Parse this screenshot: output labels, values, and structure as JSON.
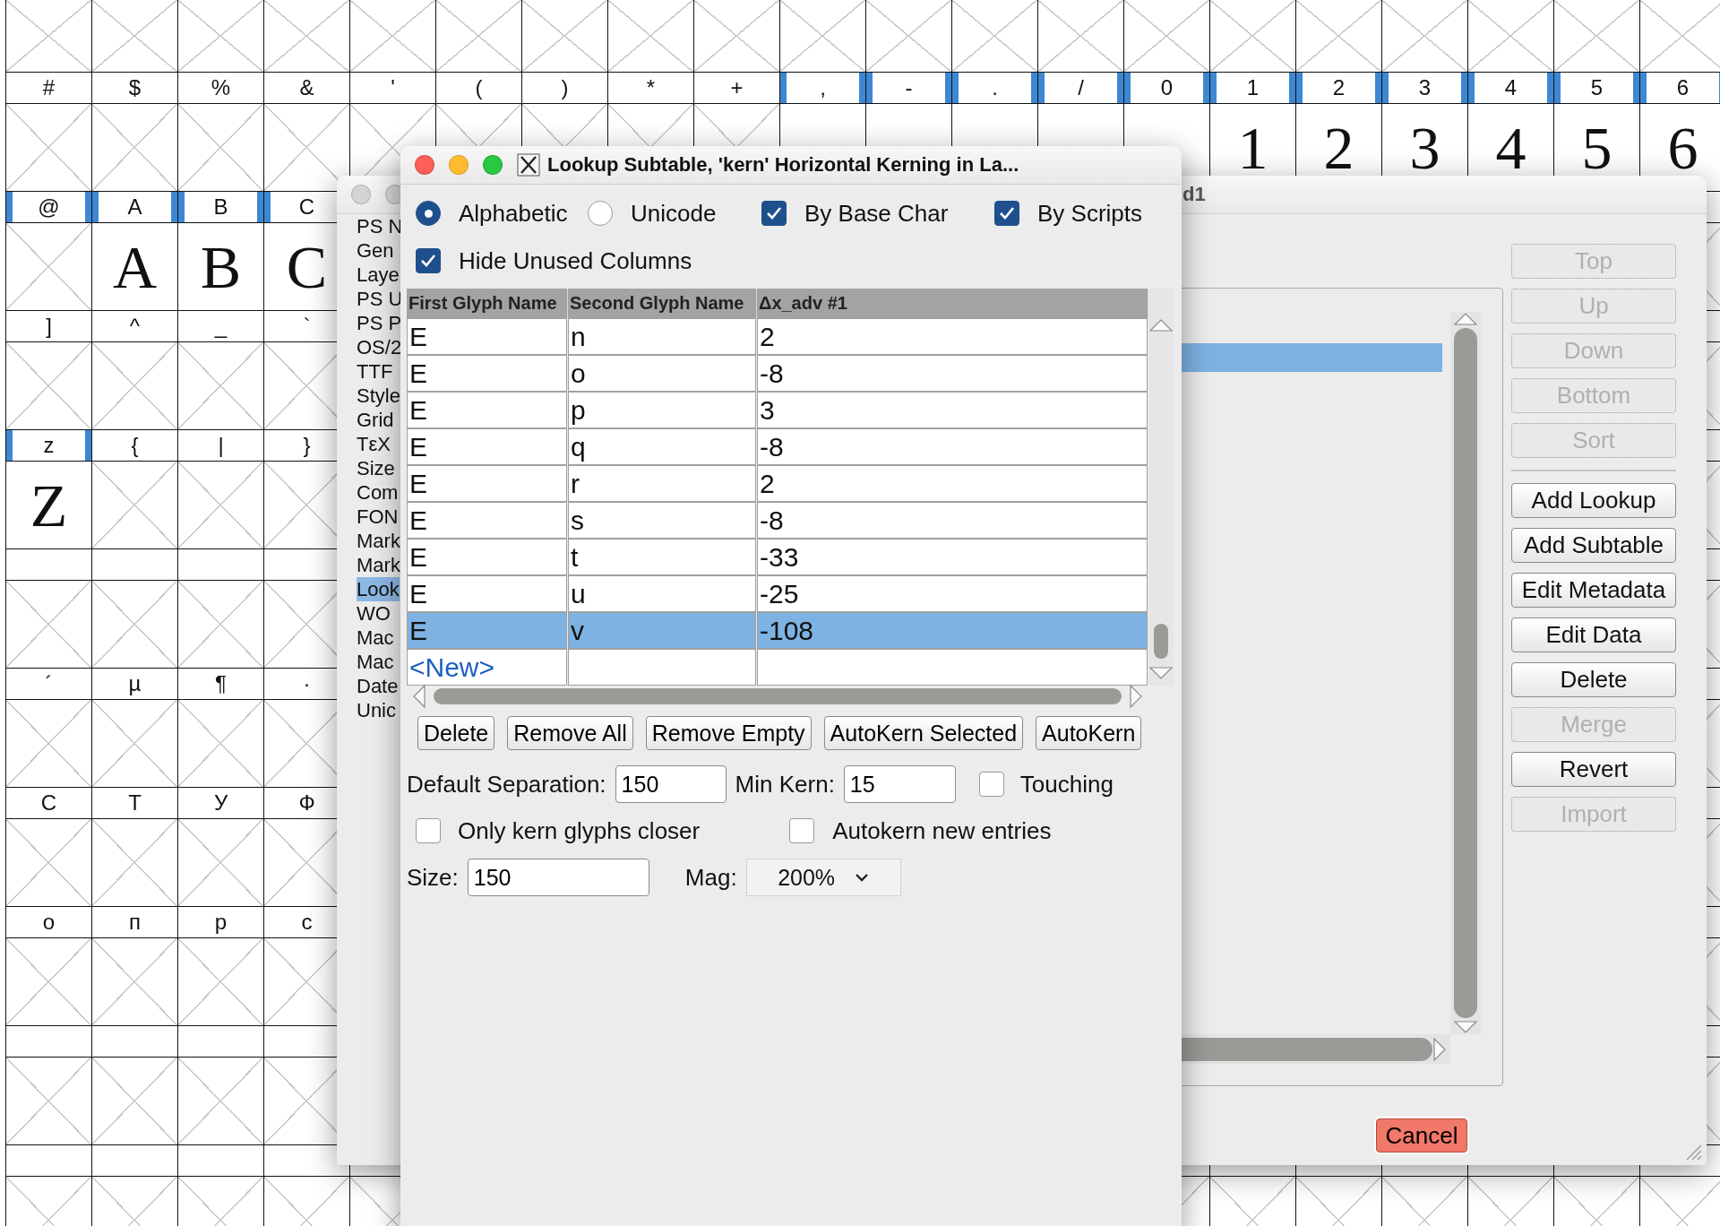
{
  "glyph_grid": {
    "rows": [
      {
        "kind": "glyphs",
        "cells": [
          {
            "label": "#",
            "marked": false,
            "kind": "empty"
          },
          {
            "label": "$",
            "marked": false,
            "kind": "empty"
          },
          {
            "label": "%",
            "marked": false,
            "kind": "empty"
          },
          {
            "label": "&",
            "marked": false,
            "kind": "empty"
          },
          {
            "label": "'",
            "marked": false,
            "kind": "empty"
          },
          {
            "label": "(",
            "marked": false,
            "kind": "empty"
          },
          {
            "label": ")",
            "marked": false,
            "kind": "empty"
          },
          {
            "label": "*",
            "marked": false,
            "kind": "empty"
          },
          {
            "label": "+",
            "marked": false,
            "kind": "empty"
          },
          {
            "label": ",",
            "marked": true,
            "kind": "glyph"
          },
          {
            "label": "-",
            "marked": true,
            "kind": "glyph"
          },
          {
            "label": ".",
            "marked": true,
            "kind": "glyph"
          },
          {
            "label": "/",
            "marked": true,
            "kind": "glyph"
          },
          {
            "label": "0",
            "marked": true,
            "kind": "glyph"
          },
          {
            "label": "1",
            "marked": true,
            "kind": "glyph",
            "glyph": "1"
          },
          {
            "label": "2",
            "marked": true,
            "kind": "glyph",
            "glyph": "2"
          },
          {
            "label": "3",
            "marked": true,
            "kind": "glyph",
            "glyph": "3"
          },
          {
            "label": "4",
            "marked": true,
            "kind": "glyph",
            "glyph": "4"
          },
          {
            "label": "5",
            "marked": true,
            "kind": "glyph",
            "glyph": "5"
          },
          {
            "label": "6",
            "marked": true,
            "kind": "glyph",
            "glyph": "6"
          }
        ]
      },
      {
        "kind": "glyphs",
        "cells": [
          {
            "label": "@",
            "marked": true,
            "kind": "empty"
          },
          {
            "label": "A",
            "marked": true,
            "kind": "glyph",
            "glyph": "A"
          },
          {
            "label": "B",
            "marked": true,
            "kind": "glyph",
            "glyph": "B"
          },
          {
            "label": "C",
            "marked": true,
            "kind": "glyph",
            "glyph": "C"
          }
        ]
      },
      {
        "kind": "glyphs",
        "cells": [
          {
            "label": "]",
            "marked": false,
            "kind": "empty"
          },
          {
            "label": "^",
            "marked": false,
            "kind": "empty"
          },
          {
            "label": "_",
            "marked": false,
            "kind": "empty"
          },
          {
            "label": "`",
            "marked": false,
            "kind": "empty"
          }
        ]
      },
      {
        "kind": "glyphs",
        "cells": [
          {
            "label": "z",
            "marked": true,
            "kind": "glyph",
            "glyph": "Z"
          },
          {
            "label": "{",
            "marked": false,
            "kind": "empty"
          },
          {
            "label": "|",
            "marked": false,
            "kind": "empty"
          },
          {
            "label": "}",
            "marked": false,
            "kind": "empty"
          }
        ]
      },
      {
        "kind": "blank"
      },
      {
        "kind": "glyphs",
        "cells": [
          {
            "label": "´",
            "marked": false,
            "kind": "empty"
          },
          {
            "label": "µ",
            "marked": false,
            "kind": "empty"
          },
          {
            "label": "¶",
            "marked": false,
            "kind": "empty"
          },
          {
            "label": "·",
            "marked": false,
            "kind": "empty"
          }
        ]
      },
      {
        "kind": "glyphs",
        "cells": [
          {
            "label": "С",
            "marked": false,
            "kind": "empty"
          },
          {
            "label": "Т",
            "marked": false,
            "kind": "empty"
          },
          {
            "label": "У",
            "marked": false,
            "kind": "empty"
          },
          {
            "label": "Ф",
            "marked": false,
            "kind": "empty"
          }
        ]
      },
      {
        "kind": "glyphs",
        "cells": [
          {
            "label": "о",
            "marked": false,
            "kind": "empty"
          },
          {
            "label": "п",
            "marked": false,
            "kind": "empty"
          },
          {
            "label": "р",
            "marked": false,
            "kind": "empty"
          },
          {
            "label": "с",
            "marked": false,
            "kind": "empty"
          }
        ]
      },
      {
        "kind": "blank"
      },
      {
        "kind": "blank"
      }
    ]
  },
  "font_info_window": {
    "title": "d1",
    "sidebar": {
      "items": [
        {
          "label": "PS N",
          "selected": false
        },
        {
          "label": "Gen",
          "selected": false
        },
        {
          "label": "Laye",
          "selected": false
        },
        {
          "label": "PS U",
          "selected": false
        },
        {
          "label": "PS P",
          "selected": false
        },
        {
          "label": "OS/2",
          "selected": false
        },
        {
          "label": "TTF",
          "selected": false
        },
        {
          "label": "Style",
          "selected": false
        },
        {
          "label": "Grid",
          "selected": false
        },
        {
          "label": "TεX",
          "selected": false
        },
        {
          "label": "Size",
          "selected": false
        },
        {
          "label": "Com",
          "selected": false
        },
        {
          "label": "FON",
          "selected": false
        },
        {
          "label": "Mark",
          "selected": false
        },
        {
          "label": "Mark",
          "selected": false
        },
        {
          "label": "Look",
          "selected": true
        },
        {
          "label": "WO",
          "selected": false
        },
        {
          "label": "Mac",
          "selected": false
        },
        {
          "label": "Mac",
          "selected": false
        },
        {
          "label": "Date",
          "selected": false
        },
        {
          "label": "Unic",
          "selected": false
        }
      ]
    },
    "lookup_list": {
      "rows": [
        {
          "selected": true
        }
      ]
    },
    "button_groups": [
      {
        "buttons": [
          {
            "label": "Top",
            "disabled": true
          },
          {
            "label": "Up",
            "disabled": true
          },
          {
            "label": "Down",
            "disabled": true
          },
          {
            "label": "Bottom",
            "disabled": true
          },
          {
            "label": "Sort",
            "disabled": true
          }
        ]
      },
      {
        "buttons": [
          {
            "label": "Add Lookup",
            "disabled": false
          },
          {
            "label": "Add Subtable",
            "disabled": false
          },
          {
            "label": "Edit Metadata",
            "disabled": false
          },
          {
            "label": "Edit Data",
            "disabled": false
          },
          {
            "label": "Delete",
            "disabled": false
          },
          {
            "label": "Merge",
            "disabled": true
          },
          {
            "label": "Revert",
            "disabled": false
          },
          {
            "label": "Import",
            "disabled": true
          }
        ]
      }
    ],
    "cancel_button": "Cancel"
  },
  "lookup_dialog": {
    "title": "Lookup Subtable, 'kern' Horizontal Kerning in La...",
    "options": [
      {
        "kind": "radio",
        "label": "Alphabetic",
        "selected": true
      },
      {
        "kind": "radio",
        "label": "Unicode",
        "selected": false
      },
      {
        "kind": "checkbox",
        "label": "By Base Char",
        "checked": true
      },
      {
        "kind": "checkbox",
        "label": "By Scripts",
        "checked": true
      }
    ],
    "hide_unused_columns": {
      "label": "Hide Unused Columns",
      "checked": true
    },
    "table": {
      "columns": [
        "First Glyph Name",
        "Second Glyph Name",
        "Δx_adv #1"
      ],
      "rows": [
        {
          "cells": [
            "E",
            "n",
            "2"
          ],
          "selected": false
        },
        {
          "cells": [
            "E",
            "o",
            "-8"
          ],
          "selected": false
        },
        {
          "cells": [
            "E",
            "p",
            "3"
          ],
          "selected": false
        },
        {
          "cells": [
            "E",
            "q",
            "-8"
          ],
          "selected": false
        },
        {
          "cells": [
            "E",
            "r",
            "2"
          ],
          "selected": false
        },
        {
          "cells": [
            "E",
            "s",
            "-8"
          ],
          "selected": false
        },
        {
          "cells": [
            "E",
            "t",
            "-33"
          ],
          "selected": false
        },
        {
          "cells": [
            "E",
            "u",
            "-25"
          ],
          "selected": false
        },
        {
          "cells": [
            "E",
            "v",
            "-108"
          ],
          "selected": true
        }
      ],
      "new_row": "<New>"
    },
    "actions": [
      "Delete",
      "Remove All",
      "Remove Empty",
      "AutoKern Selected",
      "AutoKern"
    ],
    "default_separation": {
      "label": "Default Separation:",
      "value": "150"
    },
    "min_kern": {
      "label": "Min Kern:",
      "value": "15"
    },
    "touching": {
      "label": "Touching",
      "checked": false
    },
    "only_kern_closer": {
      "label": "Only kern glyphs closer",
      "checked": false
    },
    "autokern_new": {
      "label": "Autokern new entries",
      "checked": false
    },
    "size": {
      "label": "Size:",
      "value": "150"
    },
    "mag": {
      "label": "Mag:",
      "value": "200%"
    }
  }
}
